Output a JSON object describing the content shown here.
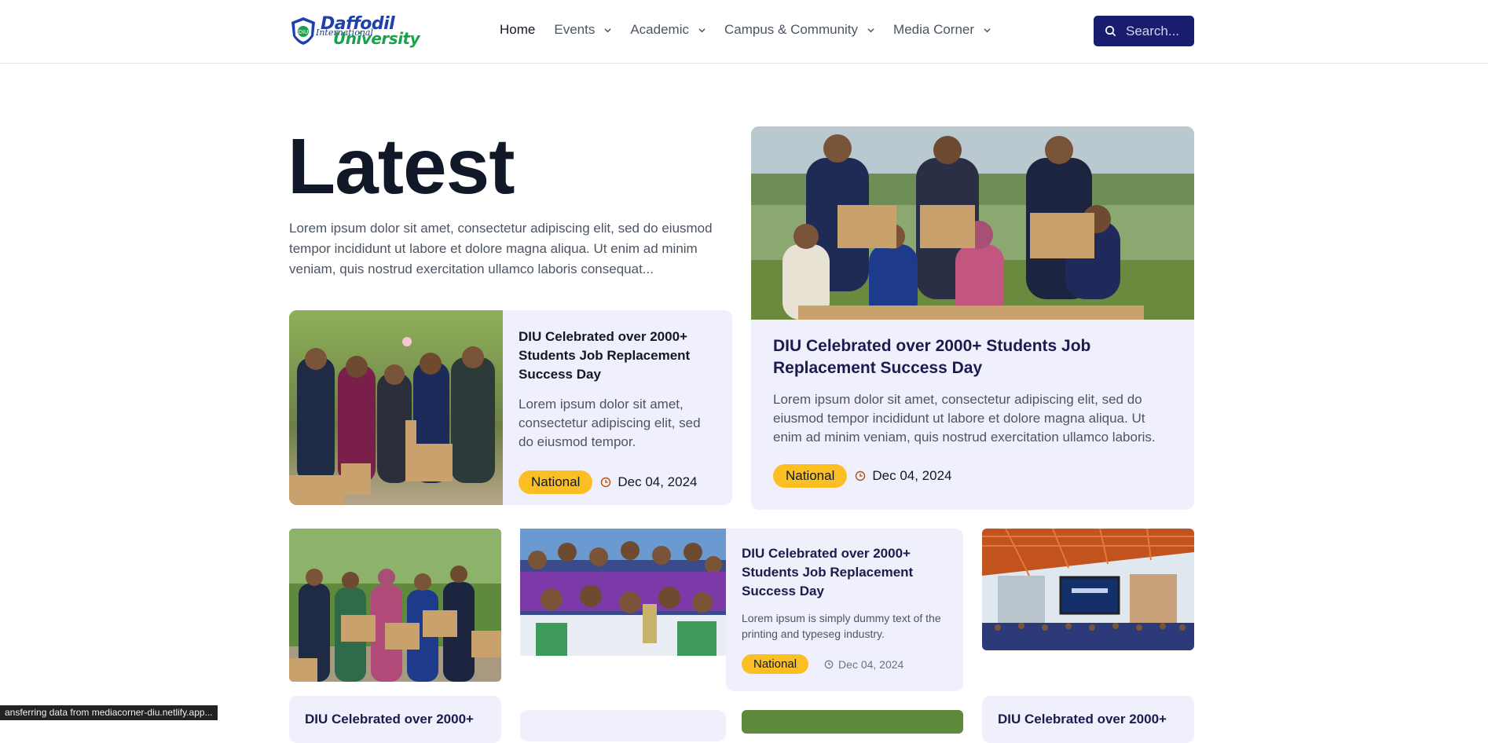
{
  "brand": {
    "line1": "Daffodil",
    "line2": "International",
    "line3": "University"
  },
  "nav": {
    "items": [
      {
        "label": "Home",
        "dropdown": false
      },
      {
        "label": "Events",
        "dropdown": true
      },
      {
        "label": "Academic",
        "dropdown": true
      },
      {
        "label": "Campus & Community",
        "dropdown": true
      },
      {
        "label": "Media Corner",
        "dropdown": true
      }
    ],
    "search_label": "Search..."
  },
  "hero": {
    "title": "Latest",
    "intro": "Lorem ipsum dolor sit amet, consectetur adipiscing elit, sed do eiusmod tempor incididunt ut labore et dolore magna aliqua. Ut enim ad minim veniam, quis nostrud exercitation ullamco laboris consequat..."
  },
  "cards": {
    "small_feature": {
      "title": "DIU Celebrated over 2000+ Students Job Replacement Success Day",
      "excerpt": "Lorem ipsum dolor sit amet, consectetur adipiscing elit, sed do eiusmod tempor.",
      "badge": "National",
      "date": "Dec 04, 2024"
    },
    "big_feature": {
      "title": "DIU Celebrated over 2000+ Students Job Replacement Success Day",
      "excerpt": "Lorem ipsum dolor sit amet, consectetur adipiscing elit, sed do eiusmod tempor incididunt ut labore et dolore magna aliqua. Ut enim ad minim veniam, quis nostrud exercitation ullamco laboris.",
      "badge": "National",
      "date": "Dec 04, 2024"
    },
    "grid_text": {
      "title": "DIU Celebrated over 2000+ Students Job Replacement Success Day",
      "excerpt": "Lorem ipsum is simply dummy text of the printing and typeseg industry.",
      "badge": "National",
      "date": "Dec 04, 2024"
    },
    "bottom_left_title": "DIU Celebrated over 2000+",
    "bottom_right_title": "DIU Celebrated over 2000+"
  },
  "status_bar": "ansferring data from mediacorner-diu.netlify.app...",
  "colors": {
    "primary": "#1a1c6e",
    "badge": "#fbbf24",
    "card_bg": "#f0f0fd",
    "heading": "#111827"
  }
}
